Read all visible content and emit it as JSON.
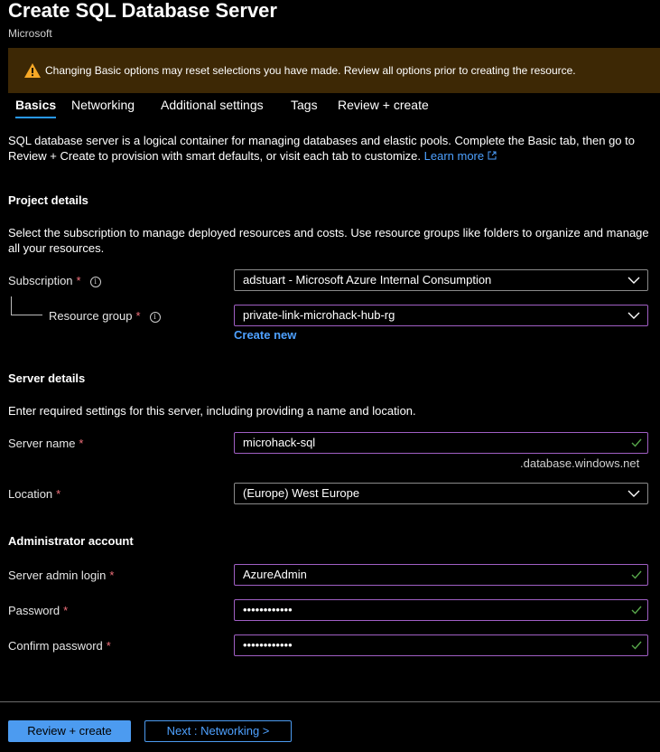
{
  "header": {
    "title": "Create SQL Database Server",
    "publisher": "Microsoft"
  },
  "warning": {
    "text": "Changing Basic options may reset selections you have made. Review all options prior to creating the resource."
  },
  "tabs": [
    {
      "label": "Basics"
    },
    {
      "label": "Networking"
    },
    {
      "label": "Additional settings"
    },
    {
      "label": "Tags"
    },
    {
      "label": "Review + create"
    }
  ],
  "intro": {
    "text": "SQL database server is a logical container for managing databases and elastic pools. Complete the Basic tab, then go to Review + Create to provision with smart defaults, or visit each tab to customize.",
    "learn_more": "Learn more"
  },
  "project": {
    "heading": "Project details",
    "description": "Select the subscription to manage deployed resources and costs. Use resource groups like folders to organize and manage all your resources.",
    "subscription_label": "Subscription",
    "subscription_value": "adstuart - Microsoft Azure Internal Consumption",
    "resource_group_label": "Resource group",
    "resource_group_value": "private-link-microhack-hub-rg",
    "create_new": "Create new"
  },
  "server": {
    "heading": "Server details",
    "description": "Enter required settings for this server, including providing a name and location.",
    "name_label": "Server name",
    "name_value": "microhack-sql",
    "name_suffix": ".database.windows.net",
    "location_label": "Location",
    "location_value": "(Europe) West Europe"
  },
  "admin": {
    "heading": "Administrator account",
    "login_label": "Server admin login",
    "login_value": "AzureAdmin",
    "password_label": "Password",
    "password_value": "••••••••••••",
    "confirm_label": "Confirm password",
    "confirm_value": "••••••••••••"
  },
  "footer": {
    "review_create": "Review + create",
    "next": "Next : Networking >"
  },
  "required_marker": "*",
  "info_glyph": "i",
  "colors": {
    "accent": "#4c9bf0",
    "warning_bg": "#3d2805",
    "warning_icon": "#f7a826",
    "valid_check": "#57a64a",
    "focus_border": "#a05fc4",
    "required": "#f1707b"
  }
}
